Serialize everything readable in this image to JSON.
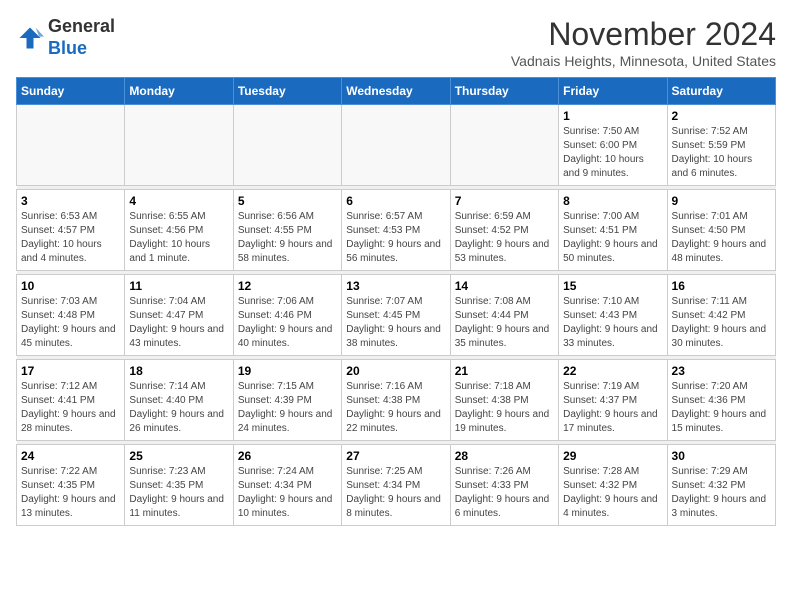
{
  "logo": {
    "general": "General",
    "blue": "Blue"
  },
  "header": {
    "month_year": "November 2024",
    "location": "Vadnais Heights, Minnesota, United States"
  },
  "days_of_week": [
    "Sunday",
    "Monday",
    "Tuesday",
    "Wednesday",
    "Thursday",
    "Friday",
    "Saturday"
  ],
  "weeks": [
    [
      {
        "day": "",
        "info": ""
      },
      {
        "day": "",
        "info": ""
      },
      {
        "day": "",
        "info": ""
      },
      {
        "day": "",
        "info": ""
      },
      {
        "day": "",
        "info": ""
      },
      {
        "day": "1",
        "info": "Sunrise: 7:50 AM\nSunset: 6:00 PM\nDaylight: 10 hours and 9 minutes."
      },
      {
        "day": "2",
        "info": "Sunrise: 7:52 AM\nSunset: 5:59 PM\nDaylight: 10 hours and 6 minutes."
      }
    ],
    [
      {
        "day": "3",
        "info": "Sunrise: 6:53 AM\nSunset: 4:57 PM\nDaylight: 10 hours and 4 minutes."
      },
      {
        "day": "4",
        "info": "Sunrise: 6:55 AM\nSunset: 4:56 PM\nDaylight: 10 hours and 1 minute."
      },
      {
        "day": "5",
        "info": "Sunrise: 6:56 AM\nSunset: 4:55 PM\nDaylight: 9 hours and 58 minutes."
      },
      {
        "day": "6",
        "info": "Sunrise: 6:57 AM\nSunset: 4:53 PM\nDaylight: 9 hours and 56 minutes."
      },
      {
        "day": "7",
        "info": "Sunrise: 6:59 AM\nSunset: 4:52 PM\nDaylight: 9 hours and 53 minutes."
      },
      {
        "day": "8",
        "info": "Sunrise: 7:00 AM\nSunset: 4:51 PM\nDaylight: 9 hours and 50 minutes."
      },
      {
        "day": "9",
        "info": "Sunrise: 7:01 AM\nSunset: 4:50 PM\nDaylight: 9 hours and 48 minutes."
      }
    ],
    [
      {
        "day": "10",
        "info": "Sunrise: 7:03 AM\nSunset: 4:48 PM\nDaylight: 9 hours and 45 minutes."
      },
      {
        "day": "11",
        "info": "Sunrise: 7:04 AM\nSunset: 4:47 PM\nDaylight: 9 hours and 43 minutes."
      },
      {
        "day": "12",
        "info": "Sunrise: 7:06 AM\nSunset: 4:46 PM\nDaylight: 9 hours and 40 minutes."
      },
      {
        "day": "13",
        "info": "Sunrise: 7:07 AM\nSunset: 4:45 PM\nDaylight: 9 hours and 38 minutes."
      },
      {
        "day": "14",
        "info": "Sunrise: 7:08 AM\nSunset: 4:44 PM\nDaylight: 9 hours and 35 minutes."
      },
      {
        "day": "15",
        "info": "Sunrise: 7:10 AM\nSunset: 4:43 PM\nDaylight: 9 hours and 33 minutes."
      },
      {
        "day": "16",
        "info": "Sunrise: 7:11 AM\nSunset: 4:42 PM\nDaylight: 9 hours and 30 minutes."
      }
    ],
    [
      {
        "day": "17",
        "info": "Sunrise: 7:12 AM\nSunset: 4:41 PM\nDaylight: 9 hours and 28 minutes."
      },
      {
        "day": "18",
        "info": "Sunrise: 7:14 AM\nSunset: 4:40 PM\nDaylight: 9 hours and 26 minutes."
      },
      {
        "day": "19",
        "info": "Sunrise: 7:15 AM\nSunset: 4:39 PM\nDaylight: 9 hours and 24 minutes."
      },
      {
        "day": "20",
        "info": "Sunrise: 7:16 AM\nSunset: 4:38 PM\nDaylight: 9 hours and 22 minutes."
      },
      {
        "day": "21",
        "info": "Sunrise: 7:18 AM\nSunset: 4:38 PM\nDaylight: 9 hours and 19 minutes."
      },
      {
        "day": "22",
        "info": "Sunrise: 7:19 AM\nSunset: 4:37 PM\nDaylight: 9 hours and 17 minutes."
      },
      {
        "day": "23",
        "info": "Sunrise: 7:20 AM\nSunset: 4:36 PM\nDaylight: 9 hours and 15 minutes."
      }
    ],
    [
      {
        "day": "24",
        "info": "Sunrise: 7:22 AM\nSunset: 4:35 PM\nDaylight: 9 hours and 13 minutes."
      },
      {
        "day": "25",
        "info": "Sunrise: 7:23 AM\nSunset: 4:35 PM\nDaylight: 9 hours and 11 minutes."
      },
      {
        "day": "26",
        "info": "Sunrise: 7:24 AM\nSunset: 4:34 PM\nDaylight: 9 hours and 10 minutes."
      },
      {
        "day": "27",
        "info": "Sunrise: 7:25 AM\nSunset: 4:34 PM\nDaylight: 9 hours and 8 minutes."
      },
      {
        "day": "28",
        "info": "Sunrise: 7:26 AM\nSunset: 4:33 PM\nDaylight: 9 hours and 6 minutes."
      },
      {
        "day": "29",
        "info": "Sunrise: 7:28 AM\nSunset: 4:32 PM\nDaylight: 9 hours and 4 minutes."
      },
      {
        "day": "30",
        "info": "Sunrise: 7:29 AM\nSunset: 4:32 PM\nDaylight: 9 hours and 3 minutes."
      }
    ]
  ]
}
